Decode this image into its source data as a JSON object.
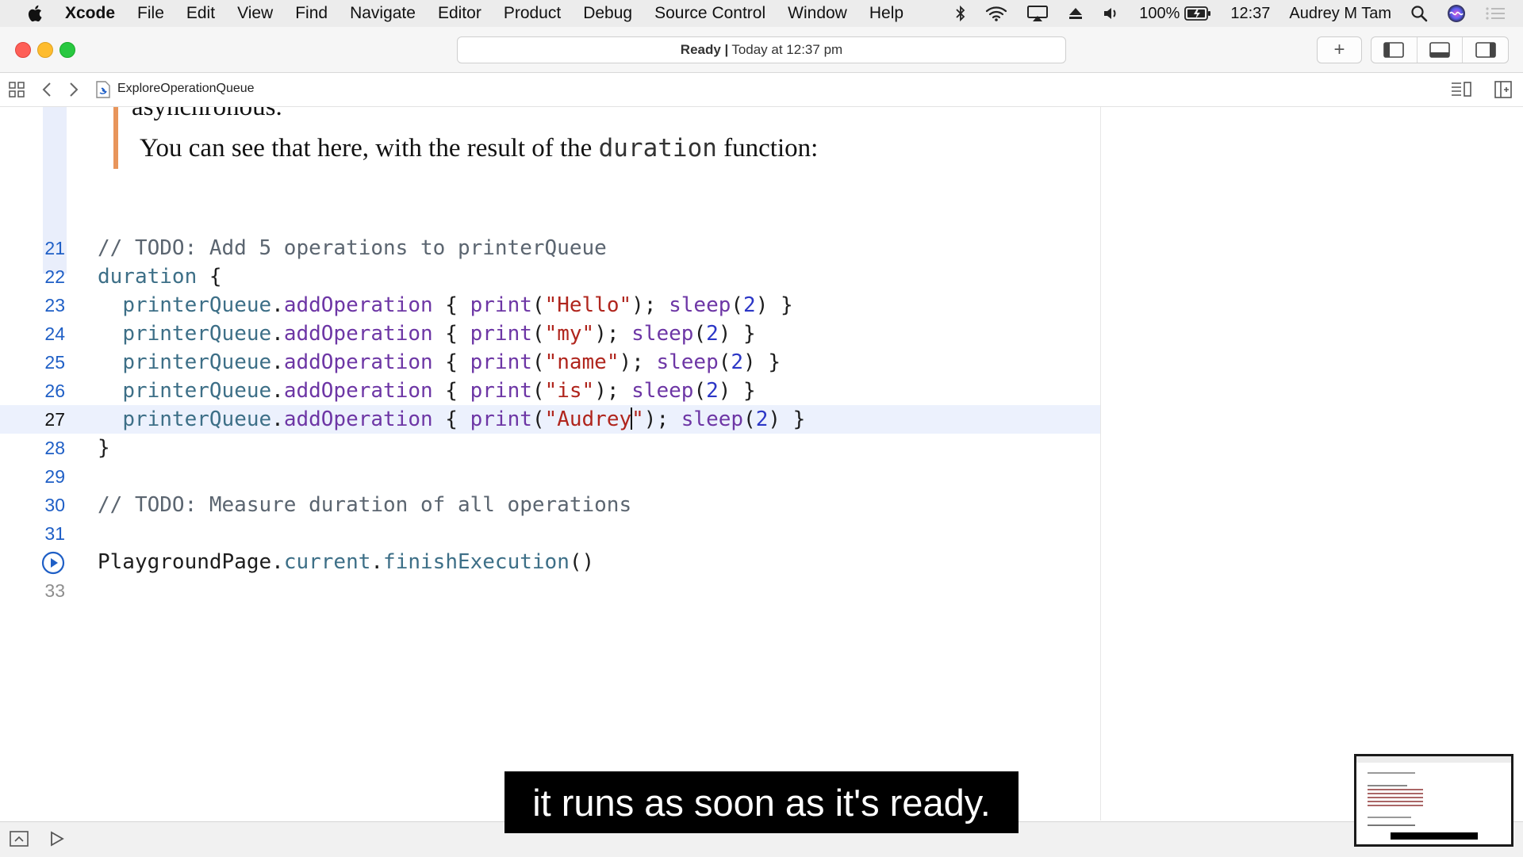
{
  "menubar": {
    "app_name": "Xcode",
    "items": [
      "File",
      "Edit",
      "View",
      "Find",
      "Navigate",
      "Editor",
      "Product",
      "Debug",
      "Source Control",
      "Window",
      "Help"
    ],
    "battery": "100%",
    "clock": "12:37",
    "user": "Audrey M Tam",
    "icons": [
      "apple-icon",
      "bluetooth-icon",
      "wifi-icon",
      "airplay-icon",
      "eject-icon",
      "volume-icon",
      "battery-icon",
      "spotlight-icon",
      "siri-icon",
      "notification-center-icon"
    ]
  },
  "toolbar": {
    "status_strong": "Ready |",
    "status_detail": "Today at 12:37 pm",
    "add_label": "+"
  },
  "jumpbar": {
    "file_name": "ExploreOperationQueue"
  },
  "markup": {
    "partial_line": "asynchronous.",
    "para_before": "You can see that here, with the result of the",
    "para_code": "duration",
    "para_after": "function:"
  },
  "code_lines": [
    {
      "number": "21",
      "text": "// TODO: Add 5 operations to printerQueue"
    },
    {
      "number": "22",
      "text": "duration {"
    },
    {
      "number": "23",
      "text": "  printerQueue.addOperation { print(\"Hello\"); sleep(2) }"
    },
    {
      "number": "24",
      "text": "  printerQueue.addOperation { print(\"my\"); sleep(2) }"
    },
    {
      "number": "25",
      "text": "  printerQueue.addOperation { print(\"name\"); sleep(2) }"
    },
    {
      "number": "26",
      "text": "  printerQueue.addOperation { print(\"is\"); sleep(2) }"
    },
    {
      "number": "27",
      "text": "  printerQueue.addOperation { print(\"Audrey\"); sleep(2) }"
    },
    {
      "number": "28",
      "text": "}"
    },
    {
      "number": "29",
      "text": ""
    },
    {
      "number": "30",
      "text": "// TODO: Measure duration of all operations"
    },
    {
      "number": "31",
      "text": ""
    },
    {
      "number": "",
      "text": "PlaygroundPage.current.finishExecution()"
    },
    {
      "number": "33",
      "text": ""
    }
  ],
  "tokens": {
    "l21": "// TODO: Add 5 operations to printerQueue",
    "duration": "duration",
    "brace_open": " {",
    "indent": "  ",
    "queue": "printerQueue",
    "dot": ".",
    "add_op": "addOperation",
    "open": " { ",
    "print": "print",
    "paren_open": "(",
    "str_hello": "\"Hello\"",
    "str_my": "\"my\"",
    "str_name": "\"name\"",
    "str_is": "\"is\"",
    "str_audrey_a": "\"Audrey",
    "str_audrey_b": "\"",
    "paren_semi": "); ",
    "sleep": "sleep",
    "num": "2",
    "close": ") }",
    "brace_close": "}",
    "l30": "// TODO: Measure duration of all operations",
    "playground": "PlaygroundPage",
    "current": "current",
    "finish": "finishExecution",
    "call": "()"
  },
  "subtitle": "it runs as soon as it's ready.",
  "colors": {
    "accent_blue": "#1f5fc6",
    "markup_bar": "#e8955b",
    "string": "#b0251d",
    "number": "#2b36c6",
    "method": "#6d36a5",
    "type": "#3d6f87",
    "comment": "#5b6570",
    "current_line": "#ecf1fd"
  }
}
